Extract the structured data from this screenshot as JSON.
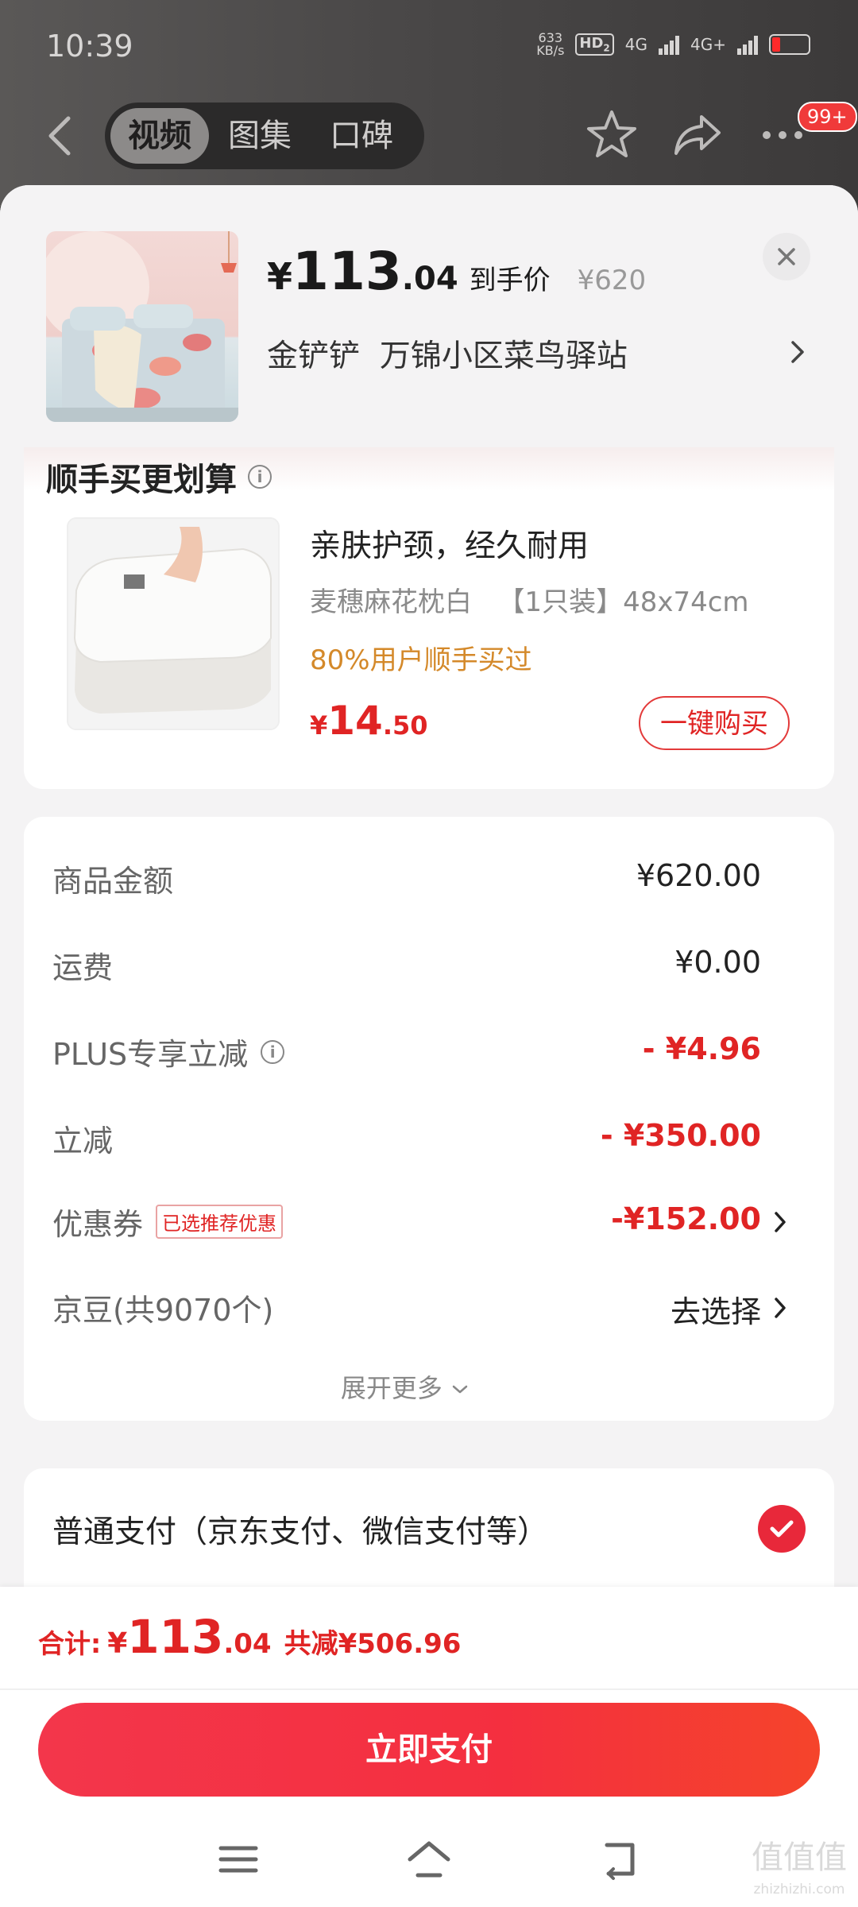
{
  "status_bar": {
    "time": "10:39",
    "net_speed_top": "633",
    "net_speed_bottom": "KB/s",
    "hd": "HD",
    "hd_sub": "2",
    "net_a": "4G",
    "net_b": "4G+"
  },
  "top_nav": {
    "tabs": [
      "视频",
      "图集",
      "口碑"
    ],
    "active_tab": "视频",
    "cart_badge": "99+"
  },
  "summary": {
    "currency": "¥",
    "price_int": "113",
    "price_dec": ".04",
    "price_label": "到手价",
    "original_price": "¥620",
    "buyer": "金铲铲",
    "address": "万锦小区菜鸟驿站"
  },
  "addon": {
    "title": "顺手买更划算",
    "slogan": "亲肤护颈，经久耐用",
    "spec_name": "麦穗麻花枕白",
    "spec_detail": "【1只装】48x74cm",
    "buyers_note": "80%用户顺手买过",
    "currency": "¥",
    "price_int": "14",
    "price_dec": ".50",
    "buy_button": "一键购买"
  },
  "amounts": {
    "rows": [
      {
        "label": "商品金额",
        "value": "¥620.00"
      },
      {
        "label": "运费",
        "value": "¥0.00"
      },
      {
        "label": "PLUS专享立减",
        "value": "- ¥4.96"
      },
      {
        "label": "立减",
        "value": "- ¥350.00"
      },
      {
        "label": "优惠券",
        "tag": "已选推荐优惠",
        "value": "-¥152.00"
      },
      {
        "label": "京豆(共9070个)",
        "value": "去选择"
      }
    ],
    "expand_more": "展开更多"
  },
  "payment": {
    "method": "普通支付（京东支付、微信支付等）"
  },
  "footer": {
    "total_label": "合计:",
    "currency": "¥",
    "total_int": "113",
    "total_dec": ".04",
    "saved": "共减¥506.96",
    "pay_button": "立即支付"
  },
  "watermark": {
    "text": "值值值",
    "sub": "zhizhizhi.com"
  },
  "colors": {
    "accent_red": "#e02424",
    "pay_button": "#f3364b",
    "buyers_note": "#d4892a"
  }
}
